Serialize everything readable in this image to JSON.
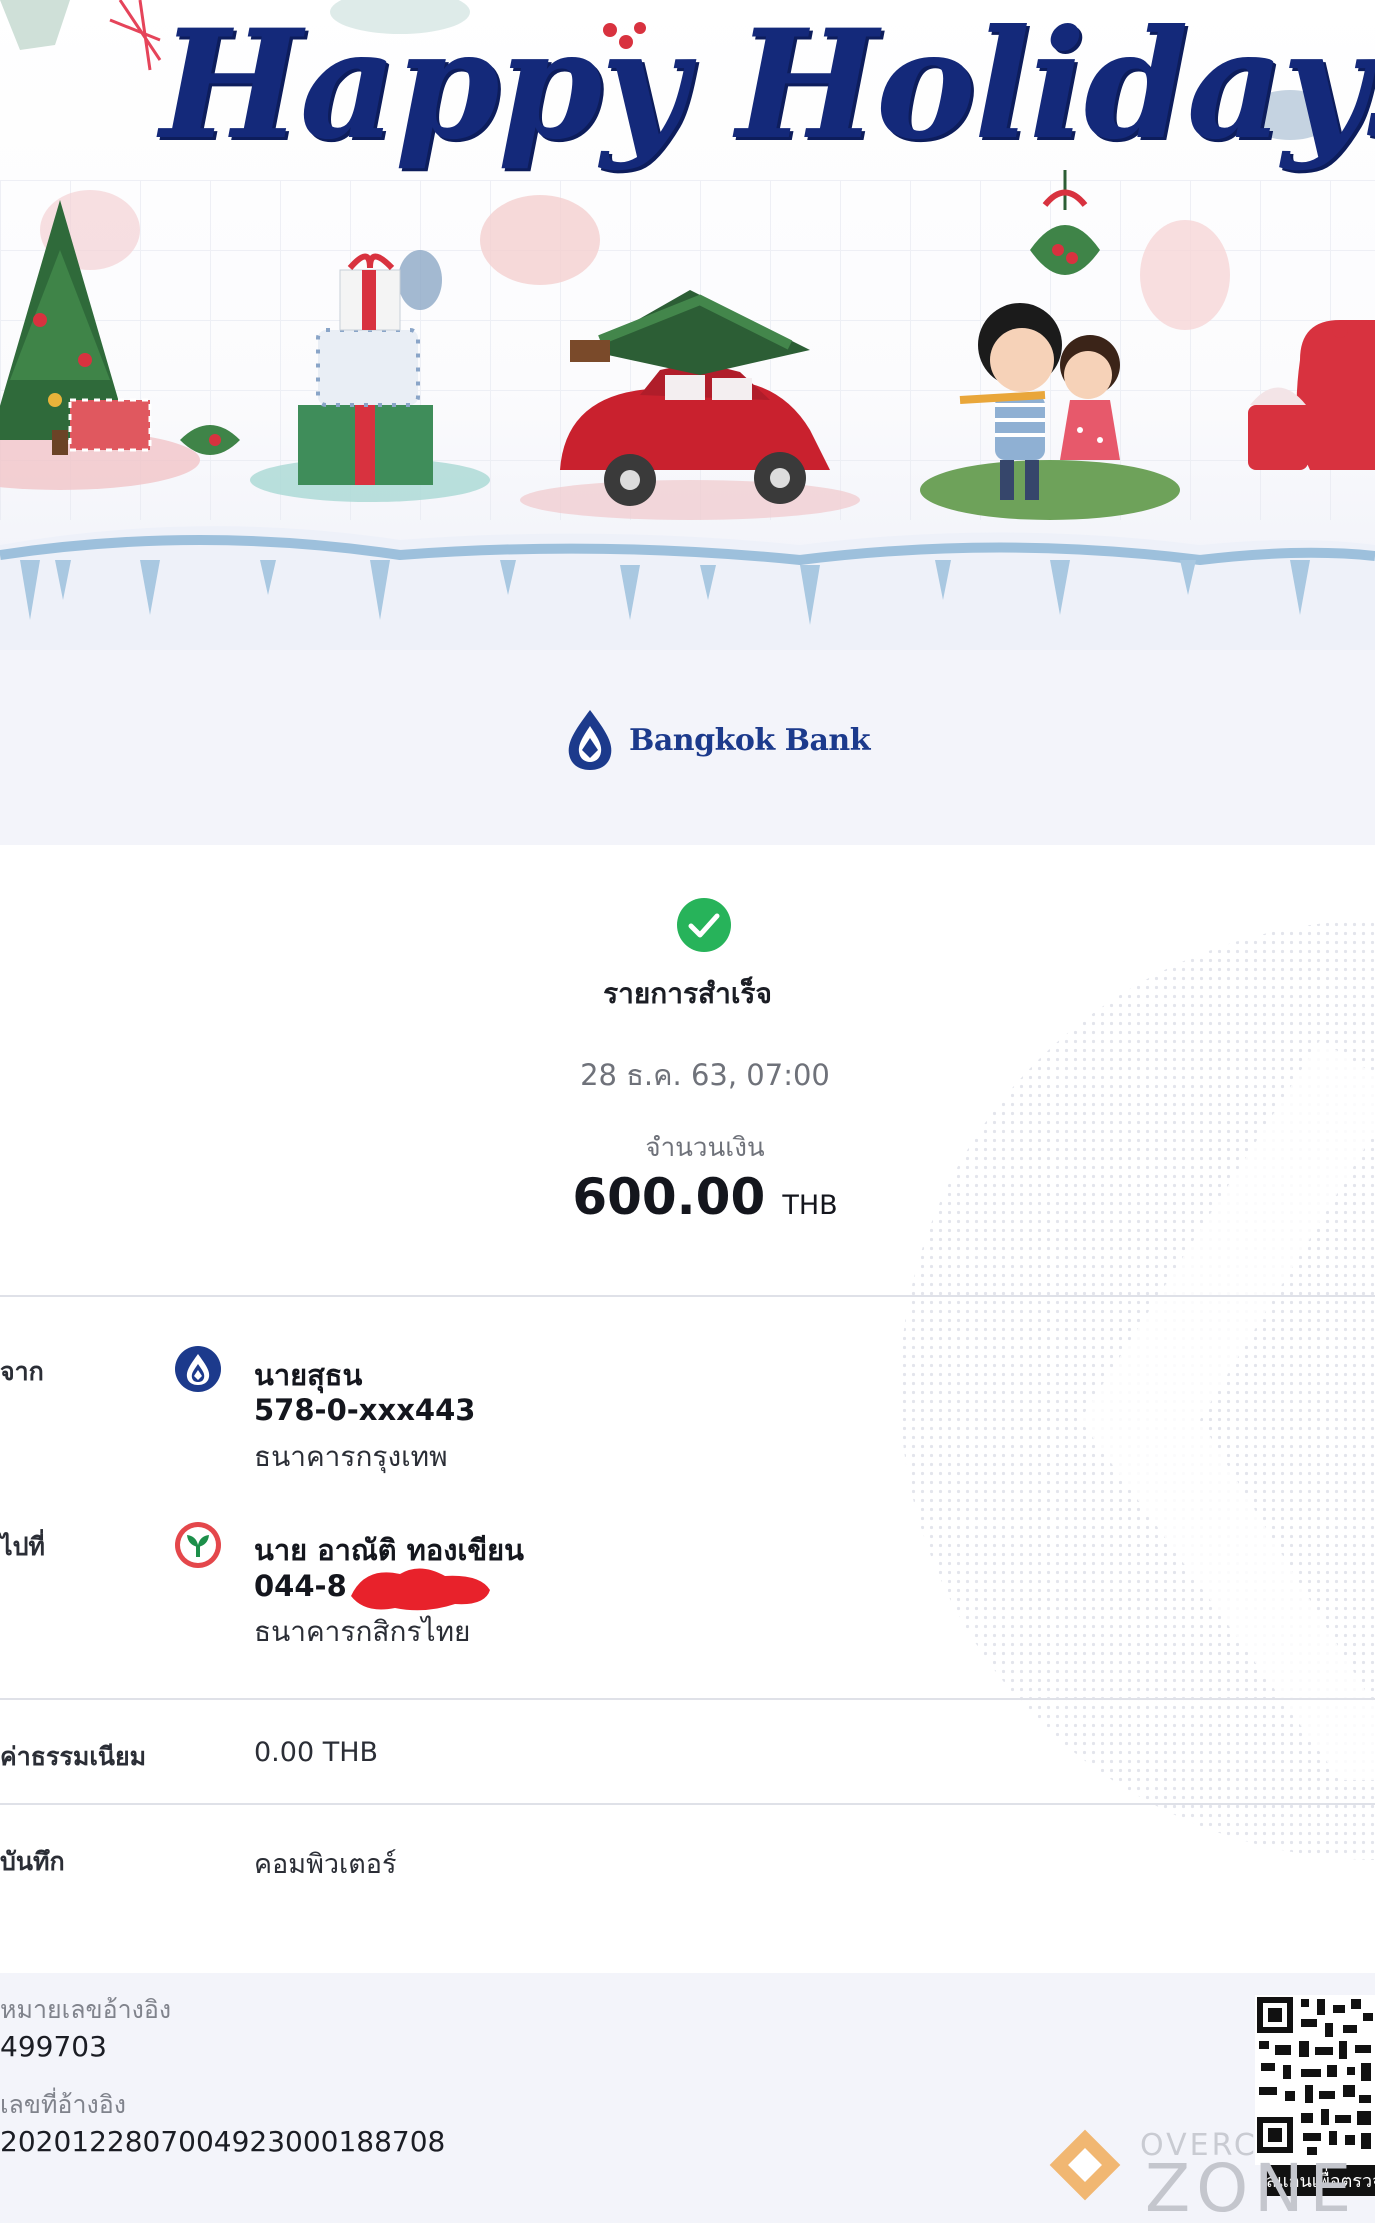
{
  "banner": {
    "title": "Happy Holidays"
  },
  "bank": {
    "name": "Bangkok Bank",
    "brand_color": "#1c3a8c"
  },
  "status": {
    "title": "รายการสำเร็จ",
    "datetime": "28 ธ.ค. 63, 07:00",
    "amount_label": "จำนวนเงิน",
    "amount": "600.00",
    "currency": "THB",
    "success_color": "#27b35a",
    "icon": "check-circle-icon"
  },
  "from": {
    "label": "จาก",
    "name": "นายสุธน",
    "account": "578-0-xxx443",
    "bank": "ธนาคารกรุงเทพ",
    "icon": "bangkok-bank-icon"
  },
  "to": {
    "label": "ไปที่",
    "name": "นาย อาณัติ ทองเขียน",
    "account": "044-8",
    "bank": "ธนาคารกสิกรไทย",
    "icon": "kasikorn-bank-icon",
    "redaction_color": "#e8222b"
  },
  "fee": {
    "label": "ค่าธรรมเนียม",
    "value": "0.00 THB"
  },
  "memo": {
    "label": "บันทึก",
    "value": "คอมพิวเตอร์"
  },
  "reference": {
    "ref_label": "หมายเลขอ้างอิง",
    "ref_value": "499703",
    "txn_label": "เลขที่อ้างอิง",
    "txn_value": "202012280700492300018870​8",
    "qr_caption": "สแกนเพื่อตรวจ"
  },
  "watermark": {
    "over": "OVERC",
    "zone": "ZONE"
  }
}
